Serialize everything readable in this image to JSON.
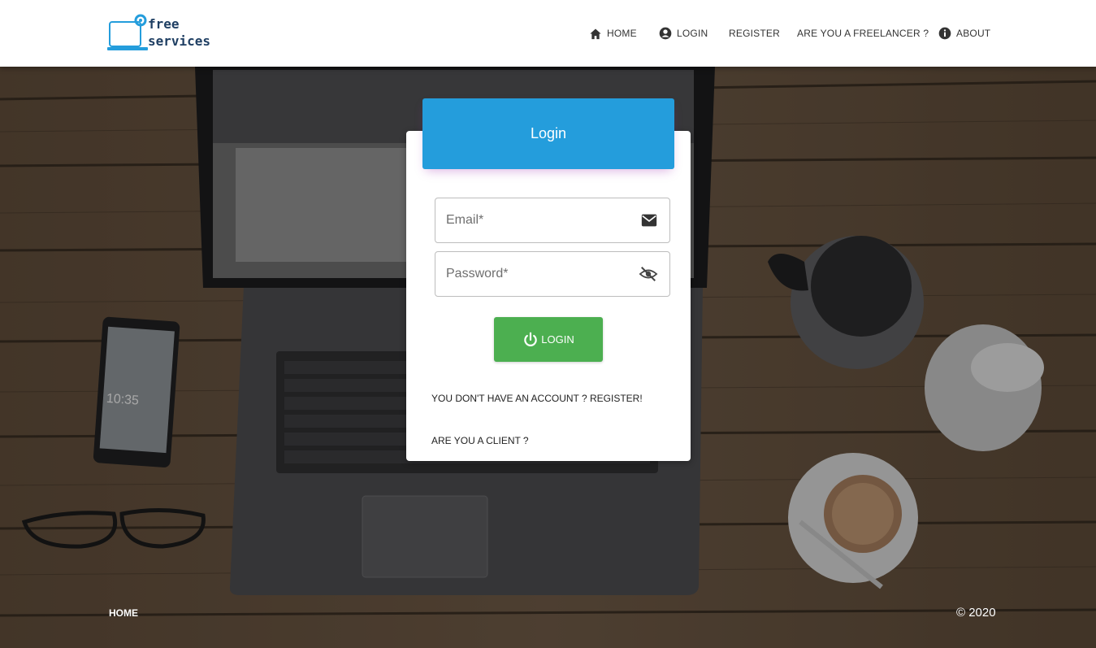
{
  "brand": {
    "line1": "free",
    "line2": "services",
    "accent": "#249ddc"
  },
  "nav": [
    {
      "label": "HOME",
      "icon": "home-icon"
    },
    {
      "label": "LOGIN",
      "icon": "account-circle-icon"
    },
    {
      "label": "REGISTER",
      "icon": ""
    },
    {
      "label": "ARE YOU A FREELANCER ?",
      "icon": ""
    },
    {
      "label": "ABOUT",
      "icon": "info-icon"
    }
  ],
  "login": {
    "title": "Login",
    "email_placeholder": "Email*",
    "email_icon": "mail-icon",
    "password_placeholder": "Password*",
    "password_icon": "visibility-off-icon",
    "button_label": "LOGIN",
    "button_icon": "power-icon",
    "button_color": "#4caf50",
    "register_link": "YOU DON'T HAVE AN ACCOUNT ? REGISTER!",
    "client_link": "ARE YOU A CLIENT ?"
  },
  "footer": {
    "home": "HOME",
    "copyright": "© 2020"
  }
}
